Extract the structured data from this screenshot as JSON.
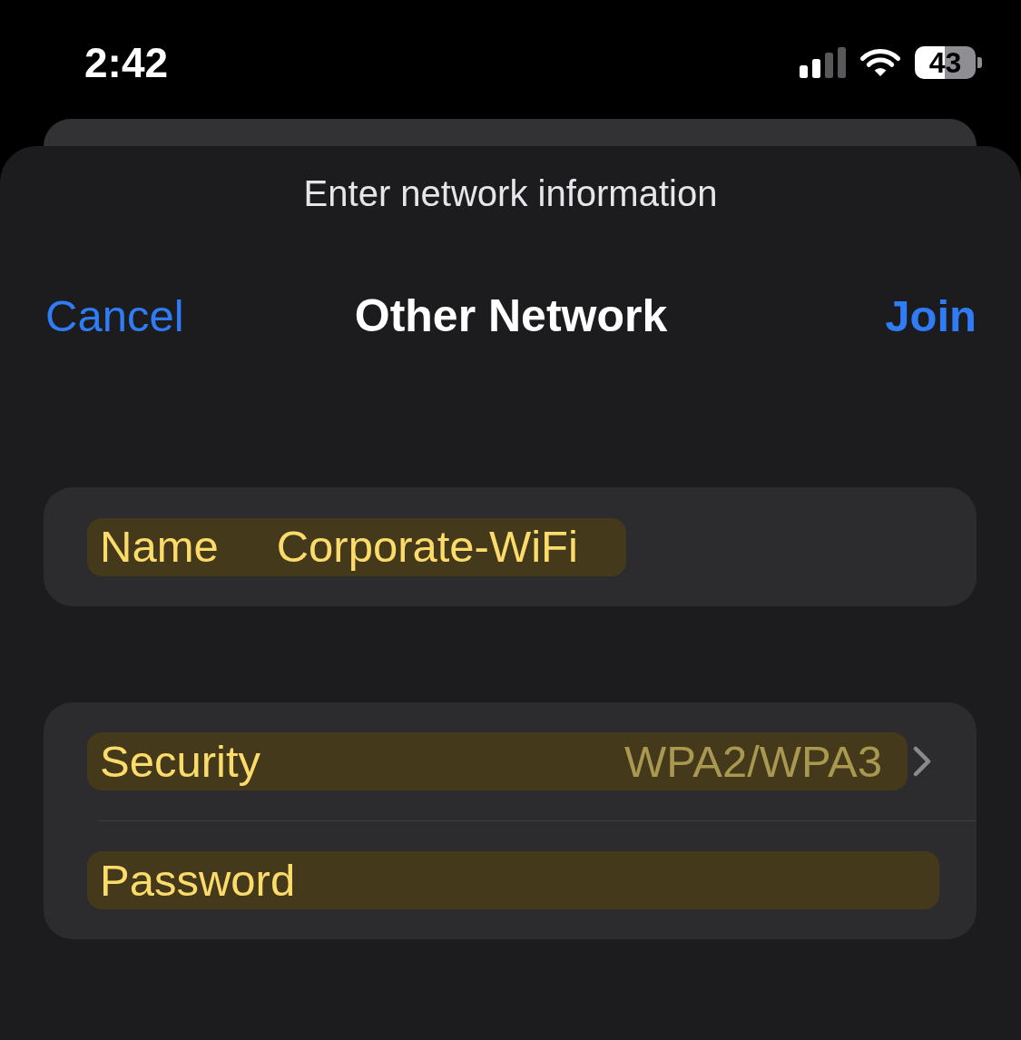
{
  "status_bar": {
    "time": "2:42",
    "battery": "43"
  },
  "sheet": {
    "prompt": "Enter network information",
    "nav": {
      "cancel": "Cancel",
      "title": "Other Network",
      "join": "Join"
    },
    "groups": [
      {
        "rows": [
          {
            "kind": "text",
            "label": "Name",
            "value": "Corporate-WiFi",
            "highlighted": true
          }
        ]
      },
      {
        "rows": [
          {
            "kind": "disclosure",
            "label": "Security",
            "value": "WPA2/WPA3",
            "highlighted": true
          },
          {
            "kind": "secure",
            "label": "Password",
            "highlighted": true
          }
        ]
      }
    ]
  }
}
